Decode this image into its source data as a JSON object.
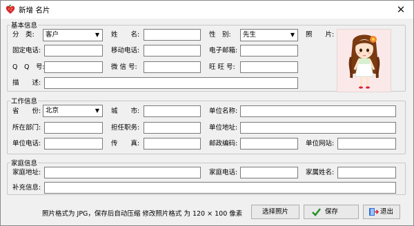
{
  "window": {
    "title": "新增 名片",
    "close_glyph": "✕"
  },
  "basic": {
    "legend": "基本信息",
    "category_label": "分　类:",
    "category_value": "客户",
    "name_label": "姓　　名:",
    "name_value": "",
    "gender_label": "性　别:",
    "gender_value": "先生",
    "photo_label": "照　　片:",
    "phone_label": "固定电话:",
    "mobile_label": "移动电话:",
    "email_label": "电子邮箱:",
    "qq_label": "Q　Q　号:",
    "wechat_label": "微 信 号:",
    "wangwang_label": "旺 旺 号:",
    "desc_label": "描　　述:"
  },
  "work": {
    "legend": "工作信息",
    "province_label": "省　　份:",
    "province_value": "北京",
    "city_label": "城　　市:",
    "company_label": "单位名称:",
    "dept_label": "所在部门:",
    "position_label": "担任职务:",
    "address_label": "单位地址:",
    "phone_label": "单位电话:",
    "fax_label": "传　　真:",
    "postcode_label": "邮政编码:",
    "website_label": "单位网站:"
  },
  "home": {
    "legend": "家庭信息",
    "address_label": "家庭地址:",
    "phone_label": "家庭电话:",
    "family_label": "家属姓名:",
    "extra_label": "补充信息:"
  },
  "footer": {
    "note": "照片格式为 JPG，保存后自动压缩 修改照片格式 为 120 × 100 像素",
    "select_photo": "选择照片",
    "save": "保存",
    "exit": "退出"
  },
  "icons": {
    "app": "heart-fruit-icon",
    "save": "checkmark-icon",
    "exit": "exit-door-icon",
    "dropdown": "chevron-down-icon"
  },
  "colors": {
    "window_bg": "#f0f0f0",
    "photo_bg": "#fbe9ea",
    "check": "#2a8f2a",
    "exit": "#2f6fd0"
  }
}
